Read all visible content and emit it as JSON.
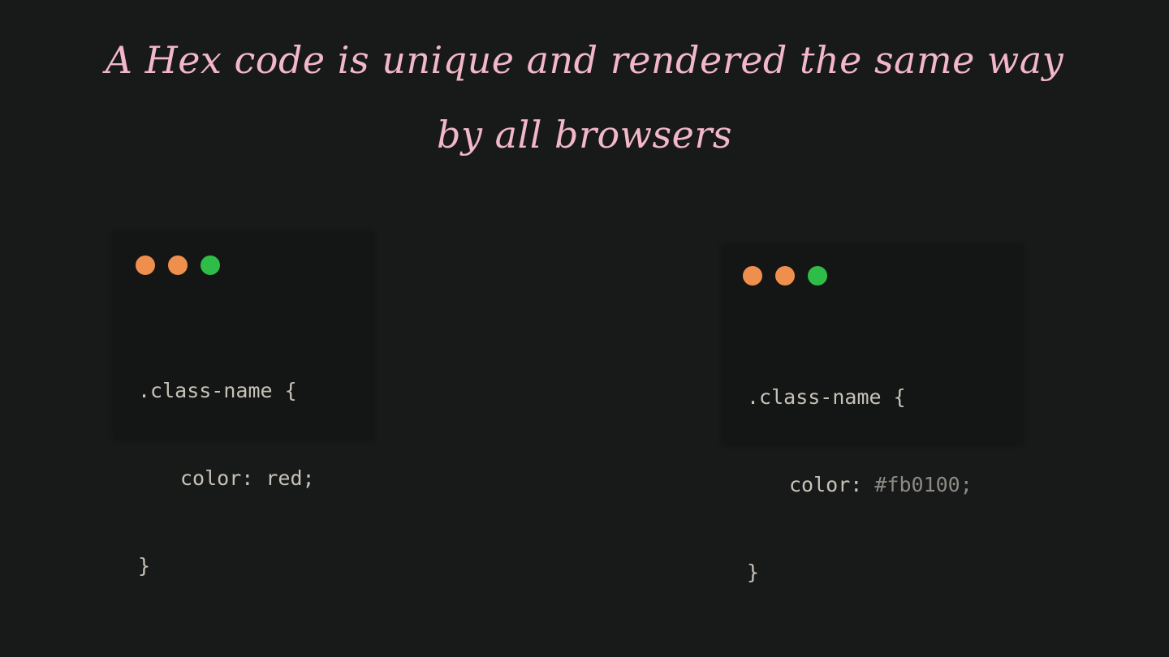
{
  "headline": "A Hex code is unique and rendered the same way by all browsers",
  "windows": [
    {
      "dots": [
        {
          "icon": "orange-dot-icon",
          "color": "#ef8f4d"
        },
        {
          "icon": "orange-dot-icon",
          "color": "#ef8f4d"
        },
        {
          "icon": "green-dot-icon",
          "color": "#2ebe48"
        }
      ],
      "code": {
        "selector_line": ".class-name {",
        "property": "color:",
        "value": "red;",
        "closing": "}"
      }
    },
    {
      "dots": [
        {
          "icon": "orange-dot-icon",
          "color": "#ef8f4d"
        },
        {
          "icon": "orange-dot-icon",
          "color": "#ef8f4d"
        },
        {
          "icon": "green-dot-icon",
          "color": "#2ebe48"
        }
      ],
      "code": {
        "selector_line": ".class-name {",
        "property": "color:",
        "value": "#fb0100;",
        "closing": "}"
      }
    }
  ],
  "colors": {
    "background": "#181a19",
    "headline": "#f2b7c9",
    "code_text": "#c7c2b8",
    "hex_value": "#8d8a84"
  }
}
